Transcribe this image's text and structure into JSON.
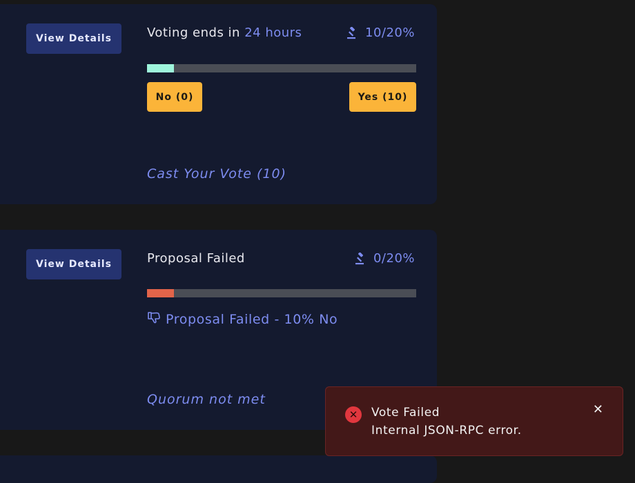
{
  "proposals": [
    {
      "view_details_label": "View Details",
      "status_prefix": "Voting ends in ",
      "status_highlight": "24 hours",
      "quorum": "10/20%",
      "quorum_icon": "gavel-icon",
      "progress": 0.1,
      "progress_color": "#9ef5dc",
      "no_label": "No (0)",
      "yes_label": "Yes (10)",
      "footer_text": "Cast Your Vote (10)"
    },
    {
      "view_details_label": "View Details",
      "status_text": "Proposal Failed",
      "quorum": "0/20%",
      "quorum_icon": "gavel-icon",
      "progress": 0.1,
      "progress_color": "#e2644a",
      "result_icon": "thumbs-down-icon",
      "result_text": "Proposal Failed - 10% No",
      "footer_text": "Quorum not met"
    }
  ],
  "toast": {
    "icon": "error-circle-icon",
    "title": "Vote Failed",
    "message": "Internal JSON-RPC error.",
    "close_icon": "close-icon",
    "color": "#e1373e"
  },
  "colors": {
    "background": "#181818",
    "card": "#141a2f",
    "accent": "#7d8cf0",
    "vote_button": "#fbb439",
    "view_button": "#253370"
  }
}
